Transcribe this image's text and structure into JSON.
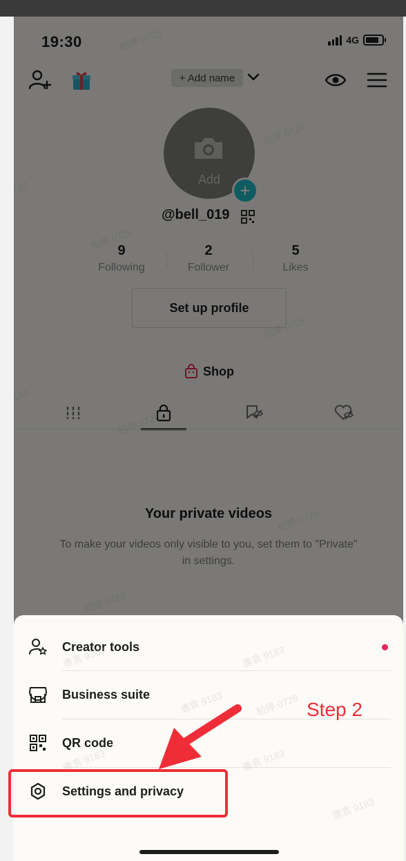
{
  "status_bar": {
    "time": "19:30",
    "network": "4G"
  },
  "header": {
    "add_name_label": "+ Add name"
  },
  "profile": {
    "avatar_add_label": "Add",
    "username": "@bell_019",
    "stats": [
      {
        "value": "9",
        "label": "Following"
      },
      {
        "value": "2",
        "label": "Follower"
      },
      {
        "value": "5",
        "label": "Likes"
      }
    ],
    "setup_button": "Set up profile",
    "shop_label": "Shop"
  },
  "tabs": [
    {
      "icon": "grid-icon"
    },
    {
      "icon": "lock-icon",
      "active": true
    },
    {
      "icon": "bookmark-hidden-icon"
    },
    {
      "icon": "heart-hidden-icon"
    }
  ],
  "content": {
    "title": "Your private videos",
    "description": "To make your videos only visible to you, set them to \"Private\" in settings."
  },
  "menu": {
    "items": [
      {
        "label": "Creator tools",
        "icon": "person-star-icon",
        "badge": true
      },
      {
        "label": "Business suite",
        "icon": "store-icon"
      },
      {
        "label": "QR code",
        "icon": "qr-code-icon"
      },
      {
        "label": "Settings and privacy",
        "icon": "gear-icon"
      }
    ]
  },
  "annotation": {
    "step_label": "Step 2",
    "color": "#ee2d38"
  },
  "watermarks": [
    "柏婷 0728",
    "唐袁 9183",
    "183"
  ]
}
